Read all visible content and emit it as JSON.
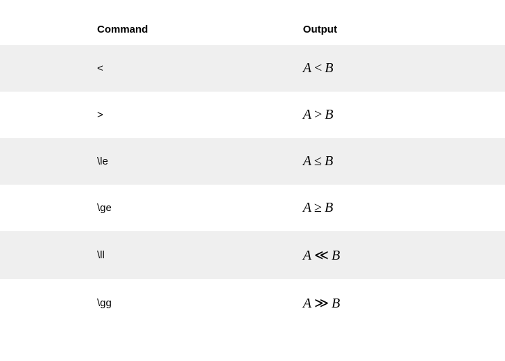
{
  "table": {
    "headers": {
      "command": "Command",
      "output": "Output"
    },
    "rows": [
      {
        "command": "<",
        "outputA": "A",
        "outputOp": "<",
        "outputB": "B"
      },
      {
        "command": ">",
        "outputA": "A",
        "outputOp": ">",
        "outputB": "B"
      },
      {
        "command": "\\le",
        "outputA": "A",
        "outputOp": "≤",
        "outputB": "B"
      },
      {
        "command": "\\ge",
        "outputA": "A",
        "outputOp": "≥",
        "outputB": "B"
      },
      {
        "command": "\\ll",
        "outputA": "A",
        "outputOp": "≪",
        "outputB": "B"
      },
      {
        "command": "\\gg",
        "outputA": "A",
        "outputOp": "≫",
        "outputB": "B"
      }
    ]
  }
}
